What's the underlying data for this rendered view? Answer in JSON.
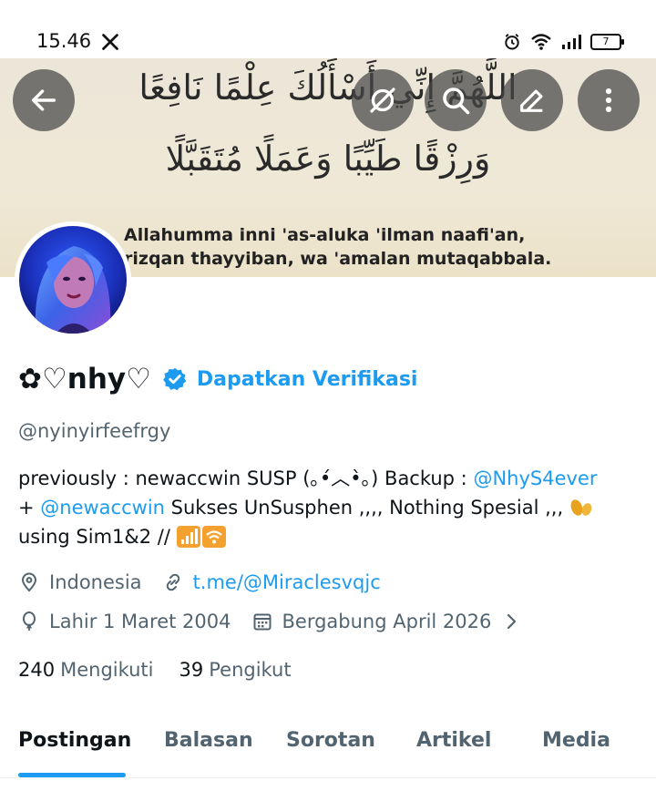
{
  "status_bar": {
    "time": "15.46",
    "battery": "7"
  },
  "banner": {
    "arabic_line_1": "اللَّهُمَّ إِنِّي أَسْأَلُكَ عِلْمًا نَافِعًا",
    "arabic_line_2": "وَرِزْقًا طَيِّبًا وَعَمَلًا مُتَقَبَّلًا",
    "translit_line_1": "Allahumma inni 'as-aluka 'ilman naafi'an,",
    "translit_line_2": "rizqan thayyiban, wa 'amalan mutaqabbala."
  },
  "profile": {
    "display_name": "✿♡nhy♡",
    "verify_link": "Dapatkan Verifikasi",
    "handle": "@nyinyirfeefrgy",
    "bio": {
      "part1": "previously : newaccwin SUSP (｡•́︿•̀｡) Backup : ",
      "mention1": "@NhyS4ever",
      "part2": "+ ",
      "mention2": "@newaccwin",
      "part3": " Sukses UnSusphen  ,,,, Nothing Spesial ,,, ",
      "part4": "using Sim1&2 // "
    },
    "location": "Indonesia",
    "website": "t.me/@Miraclesvqjc",
    "birthday": "Lahir 1 Maret 2004",
    "joined": "Bergabung April 2026",
    "following_count": "240",
    "following_label": "Mengikuti",
    "followers_count": "39",
    "followers_label": "Pengikut"
  },
  "tabs": [
    "Postingan",
    "Balasan",
    "Sorotan",
    "Artikel",
    "Media"
  ],
  "colors": {
    "accent": "#1d9bf0",
    "text": "#0f1419",
    "secondary": "#536471"
  },
  "icons": [
    "x-logo-icon",
    "alarm-icon",
    "wifi-icon",
    "signal-icon",
    "battery-icon",
    "back-arrow-icon",
    "grok-icon",
    "search-icon",
    "edit-icon",
    "more-icon",
    "verified-badge-icon",
    "location-icon",
    "link-icon",
    "balloon-icon",
    "calendar-icon",
    "chevron-right-icon"
  ]
}
